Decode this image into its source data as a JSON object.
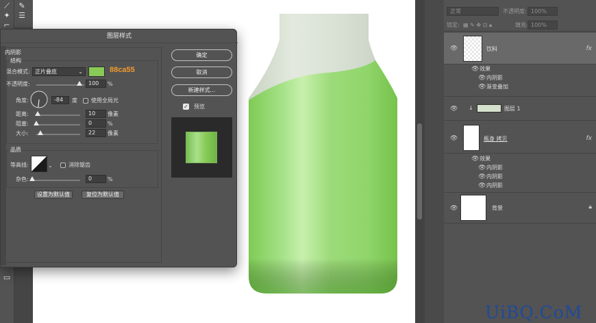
{
  "dialog": {
    "title": "图层样式",
    "section": "内阴影",
    "subsection": "结构",
    "blend_mode_label": "混合模式:",
    "blend_mode_value": "正片叠底",
    "color_hex": "88ca55",
    "opacity_label": "不透明度:",
    "opacity_value": "100",
    "opacity_unit": "%",
    "angle_label": "角度:",
    "angle_value": "-84",
    "angle_unit": "度",
    "global_light_label": "使用全局光",
    "distance_label": "距离:",
    "distance_value": "10",
    "distance_unit": "像素",
    "choke_label": "阻塞:",
    "choke_value": "0",
    "choke_unit": "%",
    "size_label": "大小:",
    "size_value": "22",
    "size_unit": "像素",
    "quality_label": "品质",
    "contour_label": "等高线:",
    "antialias_label": "消除锯齿",
    "noise_label": "杂色:",
    "noise_value": "0",
    "noise_unit": "%",
    "set_default_label": "设置为默认值",
    "reset_default_label": "复位为默认值",
    "ok_label": "确定",
    "cancel_label": "取消",
    "new_style_label": "新建样式...",
    "preview_label": "预览"
  },
  "layers_panel": {
    "blend_mode": "正常",
    "opacity_label": "不透明度:",
    "opacity_value": "100%",
    "lock_label": "锁定:",
    "fill_label": "填充:",
    "fill_value": "100%",
    "layers": [
      {
        "name": "饮料",
        "effects_label": "效果",
        "effects": [
          "内阴影",
          "渐变叠加"
        ],
        "has_fx": true
      },
      {
        "name": "图层 1"
      },
      {
        "name": "瓶身 拷贝",
        "effects_label": "效果",
        "effects": [
          "内阴影",
          "内阴影",
          "内阴影"
        ],
        "has_fx": true
      },
      {
        "name": "背景"
      }
    ],
    "fx_glyph": "fx"
  },
  "colors": {
    "accent_orange": "#f29a2e",
    "inner_shadow_color": "#88ca55",
    "bottle_green": "#8fd46a",
    "panel_bg": "#535353"
  },
  "watermark": "UiBQ.CoM"
}
